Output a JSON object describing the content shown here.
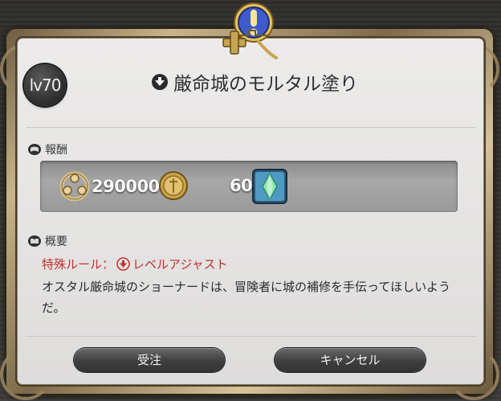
{
  "quest": {
    "level": "lv70",
    "title": "厳命城のモルタル塗り"
  },
  "rewards": {
    "label": "報酬",
    "gil": "290000",
    "seals": "606"
  },
  "summary": {
    "label": "概要",
    "rule": "特殊ルール：",
    "rule_value": "レベルアジャスト",
    "description": "オスタル厳命城のショーナードは、冒険者に城の補修を手伝ってほしいようだ。"
  },
  "actions": {
    "accept": "受注",
    "cancel": "キャンセル"
  },
  "colors": {
    "rule_red": "#c0322f",
    "crest_blue": "#3f5bc9",
    "crest_gold": "#d8b84a"
  },
  "icons": {
    "crest": "exclamation-quest-crest",
    "title": "quest-marker-icon",
    "gil": "gil-coin-icon",
    "seal": "seal-coin-icon",
    "item": "crystal-item-icon"
  }
}
